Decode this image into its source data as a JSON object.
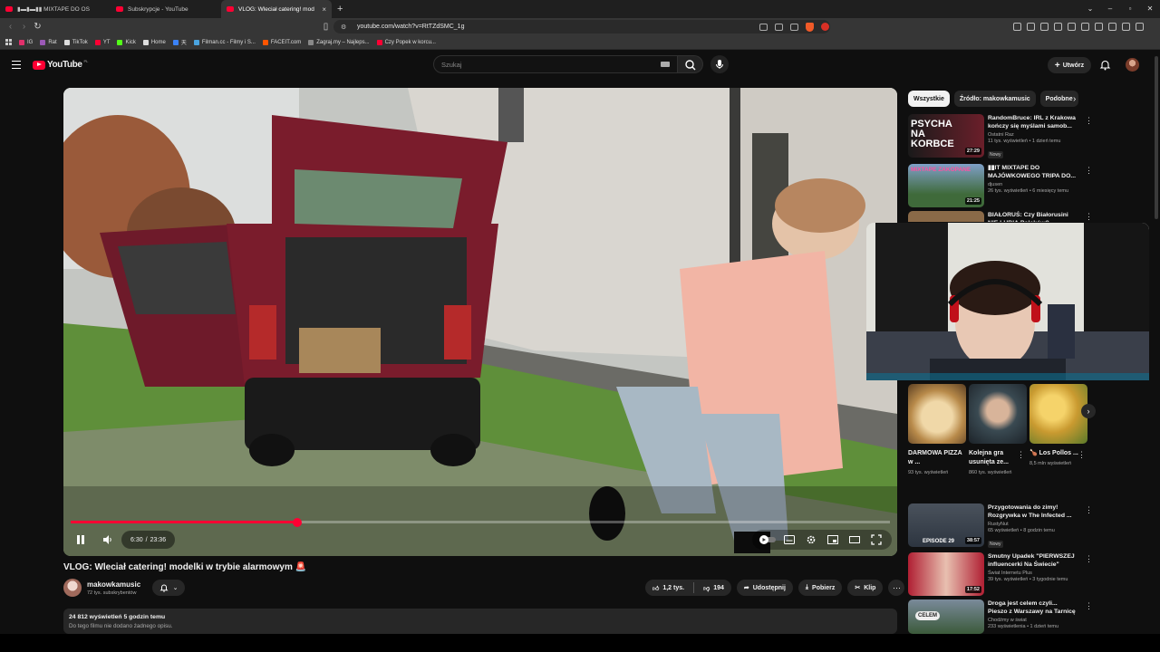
{
  "browser": {
    "tabs": [
      {
        "label": "▮▬▮▬▮▮ MIXTAPE DO OS"
      },
      {
        "label": "Subskrypcje - YouTube"
      },
      {
        "label": "VLOG: Wleciał catering! mod"
      }
    ],
    "url": "youtube.com/watch?v=RtTZdSMC_1g",
    "bookmarks": [
      {
        "label": "IG",
        "color": "#e1306c"
      },
      {
        "label": "Rat",
        "color": "#9b59b6"
      },
      {
        "label": "TikTok",
        "color": "#dddddd"
      },
      {
        "label": "YT",
        "color": "#ff0033"
      },
      {
        "label": "Kick",
        "color": "#53fc18"
      },
      {
        "label": "Home",
        "color": "#dddddd"
      },
      {
        "label": "天",
        "color": "#3b82f6"
      },
      {
        "label": "Filman.cc - Filmy i S...",
        "color": "#4aa3df"
      },
      {
        "label": "FACEIT.com",
        "color": "#ff5500"
      },
      {
        "label": "Zagraj.my – Najleps...",
        "color": "#888888"
      },
      {
        "label": "Czy Popek w korcu...",
        "color": "#ff0033"
      }
    ]
  },
  "yt": {
    "logo": "YouTube",
    "country": "PL",
    "search_placeholder": "Szukaj",
    "create_label": "Utwórz"
  },
  "player": {
    "time_current": "6:30",
    "time_separator": "/",
    "time_total": "23:36",
    "progress": 0.276
  },
  "video": {
    "title": "VLOG: Wleciał catering! modelki w trybie alarmowym 🚨",
    "channel": "makowkamusic",
    "subscribers": "72 tys. subskrybentów",
    "likes": "1,2 tys.",
    "dislikes": "194",
    "share_label": "Udostępnij",
    "download_label": "Pobierz",
    "clip_label": "Klip",
    "views_date": "24 812 wyświetleń  5 godzin temu",
    "description": "Do tego filmu nie dodano żadnego opisu."
  },
  "sidebar": {
    "chips": [
      "Wszystkie",
      "Źródło: makowkamusic",
      "Podobne"
    ],
    "recs_top": [
      {
        "title": "RandomBruce: IRL z Krakowa kończy się myślami samob...",
        "channel": "Ostatni Raz",
        "meta": "11 tys. wyświetleń • 1 dzień temu",
        "badge": "Nowy",
        "duration": "27:29",
        "thumb_text": "PSYCHA NA KORBCE",
        "thumb_color": "#6b1f2a"
      },
      {
        "title": "▮▮IT MIXTAPE DO MAJÓWKOWEGO TRIPA DO...",
        "channel": "djusen",
        "meta": "26 tys. wyświetleń • 6 miesięcy temu",
        "badge": "",
        "duration": "21:25",
        "thumb_text": "MIXTAPE ZAKOPANE",
        "thumb_color": "#3f6a3a"
      },
      {
        "title": "BIAŁORUŚ: Czy Białorusini NIE LUBIĄ Polaków? Szczeblikow...",
        "channel": "",
        "meta": "",
        "badge": "",
        "duration": "",
        "thumb_text": "",
        "thumb_color": "#8a6a48"
      }
    ],
    "shorts": [
      {
        "title": "DARMOWA PIZZA w ...",
        "views": "93 tys. wyświetleń",
        "color": "#b88a4a"
      },
      {
        "title": "Kolejna gra usunięta ze...",
        "views": "860 tys. wyświetleń",
        "color": "#3a4a52"
      },
      {
        "title": "🍗 Los Pollos ...",
        "views": "8,5 mln wyświetleń",
        "color": "#c99a30"
      }
    ],
    "recs_bottom": [
      {
        "title": "Przygotowania do zimy! Rozgrywka w The Infected ...",
        "channel": "RustyNut",
        "meta": "65 wyświetleń • 8 godzin temu",
        "badge": "Nowy",
        "duration": "38:57",
        "thumb_text": "EPISODE 29",
        "thumb_color": "#2d3540"
      },
      {
        "title": "Smutny Upadek \"PIERWSZEJ influencerki Na Świecie\"",
        "channel": "Świat Internetu Plus",
        "meta": "39 tys. wyświetleń • 3 tygodnie temu",
        "badge": "",
        "duration": "17:52",
        "thumb_text": "",
        "thumb_color": "#b01f33"
      },
      {
        "title": "Droga jest celem czyli... Pieszo z Warszawy na Tarnicę - dzień ...",
        "channel": "Chodźmy w świat",
        "meta": "233 wyświetlenia • 1 dzień temu",
        "badge": "",
        "duration": "",
        "thumb_text": "CELEM",
        "thumb_color": "#3b5a3a"
      }
    ]
  },
  "colors": {
    "accent": "#ff0033",
    "background": "#0f0f0f",
    "surface": "#272727"
  }
}
